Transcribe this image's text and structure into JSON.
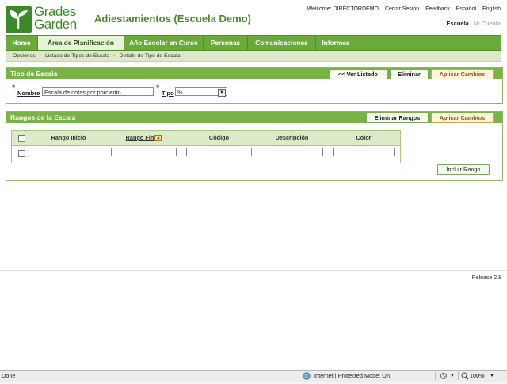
{
  "app": {
    "logo_line1": "Grades",
    "logo_line2": "Garden",
    "title": "Adiestamientos (Escuela Demo)"
  },
  "toplinks": {
    "welcome": "Welcome: DIRECTORDEMO",
    "logout": "Cerrar Sesión",
    "feedback": "Feedback",
    "spanish": "Español",
    "english": "English"
  },
  "schoollinks": {
    "current": "Escuela",
    "separator": "|",
    "other": "Mi Cuenta"
  },
  "nav": {
    "tabs": [
      "Home",
      "Área de Planificación",
      "Año Escolar en Curso",
      "Personas",
      "Comunicaciones",
      "Informes"
    ]
  },
  "breadcrumb": [
    "Opciones",
    "Listado de Tipos de Escala",
    "Detalle de Tipo de Escala"
  ],
  "tipo_panel": {
    "title": "Tipo de Escala",
    "buttons": {
      "list": "<< Ver Listado",
      "delete": "Eliminar",
      "apply": "Aplicar Cambios"
    },
    "nombre_label": "Nombre",
    "nombre_value": "Escala de notas por porciento",
    "tipo_label": "Tipo",
    "tipo_value": "%"
  },
  "rangos_panel": {
    "title": "Rangos de la Escala",
    "buttons": {
      "delete": "Eliminar Rangos",
      "apply": "Aplicar Cambios",
      "add": "Incluir Rango"
    },
    "columns": [
      "Rango Inicio",
      "Rango Fin",
      "Código",
      "Descripción",
      "Color"
    ]
  },
  "release": "Release 2.8",
  "statusbar": {
    "left": "Done",
    "zone": "Internet | Protected Mode: On",
    "zoom": "100%"
  },
  "colors": {
    "brand_green": "#77b345",
    "nav_green": "#6aaa3a",
    "accent_orange": "#d9a24a"
  }
}
